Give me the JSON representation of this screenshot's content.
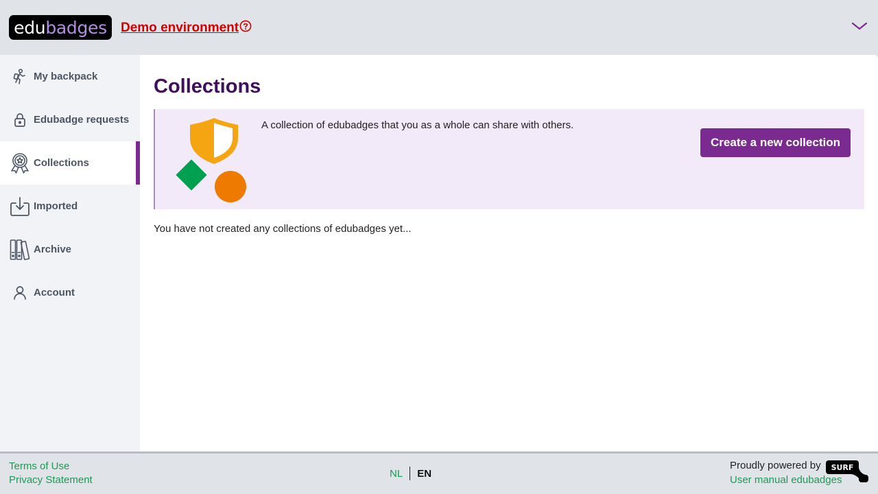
{
  "header": {
    "logo_edu": "edu",
    "logo_badges": "badges",
    "demo_label": "Demo environment",
    "demo_color": "#d40000"
  },
  "sidebar": {
    "items": [
      {
        "label": "My backpack",
        "icon": "backpack-icon",
        "active": false
      },
      {
        "label": "Edubadge requests",
        "icon": "lock-icon",
        "active": false
      },
      {
        "label": "Collections",
        "icon": "award-badge-icon",
        "active": true
      },
      {
        "label": "Imported",
        "icon": "import-icon",
        "active": false
      },
      {
        "label": "Archive",
        "icon": "archive-icon",
        "active": false
      },
      {
        "label": "Account",
        "icon": "user-icon",
        "active": false
      }
    ]
  },
  "main": {
    "title": "Collections",
    "panel_text": "A collection of edubadges that you as a whole can share with others.",
    "create_button_label": "Create a new collection",
    "empty_message": "You have not created any collections of edubadges yet..."
  },
  "footer": {
    "terms": "Terms of Use",
    "privacy": "Privacy Statement",
    "lang_nl": "NL",
    "lang_en": "EN",
    "powered_by": "Proudly powered by",
    "surf_logo_text": "SURF",
    "user_manual": "User manual edubadges"
  },
  "colors": {
    "accent": "#7b2a8f",
    "title": "#3f0e5c",
    "panel_bg": "#f2e9f9",
    "link_green": "#1a9b55",
    "shield_orange": "#f5a511",
    "diamond_green": "#00a050",
    "circle_orange": "#ef7a00"
  }
}
